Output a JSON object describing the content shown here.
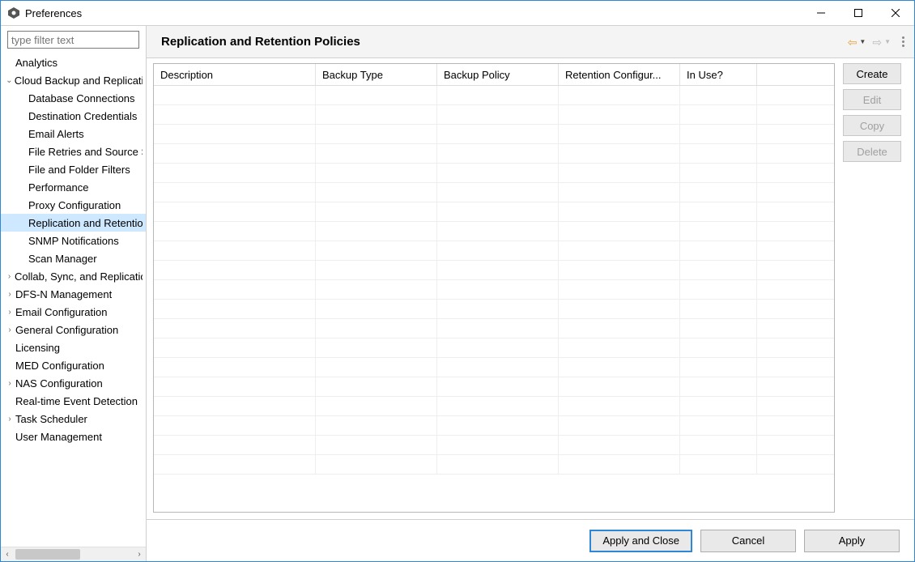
{
  "window": {
    "title": "Preferences"
  },
  "filter": {
    "placeholder": "type filter text"
  },
  "tree": {
    "items": [
      {
        "label": "Analytics",
        "indent": 0,
        "arrow": ""
      },
      {
        "label": "Cloud Backup and Replication",
        "indent": 0,
        "arrow": "v"
      },
      {
        "label": "Database Connections",
        "indent": 1,
        "arrow": ""
      },
      {
        "label": "Destination Credentials",
        "indent": 1,
        "arrow": ""
      },
      {
        "label": "Email Alerts",
        "indent": 1,
        "arrow": ""
      },
      {
        "label": "File Retries and Source Snapshots",
        "indent": 1,
        "arrow": ""
      },
      {
        "label": "File and Folder Filters",
        "indent": 1,
        "arrow": ""
      },
      {
        "label": "Performance",
        "indent": 1,
        "arrow": ""
      },
      {
        "label": "Proxy Configuration",
        "indent": 1,
        "arrow": ""
      },
      {
        "label": "Replication and Retention Policies",
        "indent": 1,
        "arrow": "",
        "selected": true
      },
      {
        "label": "SNMP Notifications",
        "indent": 1,
        "arrow": ""
      },
      {
        "label": "Scan Manager",
        "indent": 1,
        "arrow": ""
      },
      {
        "label": "Collab, Sync, and Replication",
        "indent": 0,
        "arrow": ">"
      },
      {
        "label": "DFS-N Management",
        "indent": 0,
        "arrow": ">"
      },
      {
        "label": "Email Configuration",
        "indent": 0,
        "arrow": ">"
      },
      {
        "label": "General Configuration",
        "indent": 0,
        "arrow": ">"
      },
      {
        "label": "Licensing",
        "indent": 0,
        "arrow": ""
      },
      {
        "label": "MED Configuration",
        "indent": 0,
        "arrow": ""
      },
      {
        "label": "NAS Configuration",
        "indent": 0,
        "arrow": ">"
      },
      {
        "label": "Real-time Event Detection",
        "indent": 0,
        "arrow": ""
      },
      {
        "label": "Task Scheduler",
        "indent": 0,
        "arrow": ">"
      },
      {
        "label": "User Management",
        "indent": 0,
        "arrow": ""
      }
    ]
  },
  "page": {
    "title": "Replication and Retention Policies"
  },
  "table": {
    "columns": {
      "description": "Description",
      "backup_type": "Backup Type",
      "backup_policy": "Backup Policy",
      "retention": "Retention Configur...",
      "in_use": "In Use?"
    }
  },
  "buttons": {
    "create": "Create",
    "edit": "Edit",
    "copy": "Copy",
    "delete": "Delete"
  },
  "footer": {
    "apply_close": "Apply and Close",
    "cancel": "Cancel",
    "apply": "Apply"
  }
}
